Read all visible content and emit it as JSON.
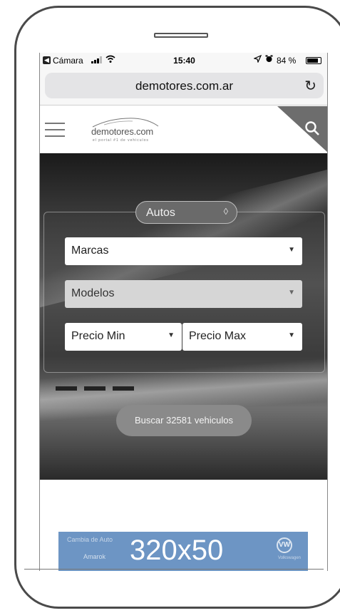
{
  "status_bar": {
    "back_glyph": "◀",
    "carrier": "Cámara",
    "time": "15:40",
    "battery": "84 %",
    "battery_level": 0.84
  },
  "browser": {
    "url": "demotores.com.ar",
    "reload_glyph": "↻"
  },
  "site": {
    "logo_text": "demotores.com",
    "logo_tagline": "el portal #1 de vehiculos"
  },
  "search": {
    "vehicle_type": "Autos",
    "brand_placeholder": "Marcas",
    "model_placeholder": "Modelos",
    "price_min_placeholder": "Precio Min",
    "price_max_placeholder": "Precio Max",
    "submit_label": "Buscar 32581 vehiculos"
  },
  "ad": {
    "size_label": "320x50",
    "line1": "Cambia de Auto",
    "line2": "Amarok",
    "brand": "Volkswagen",
    "logo_glyph": "VW",
    "background_color": "#6d95c4"
  },
  "icons": {
    "caret": "▼",
    "updown": "◊"
  }
}
